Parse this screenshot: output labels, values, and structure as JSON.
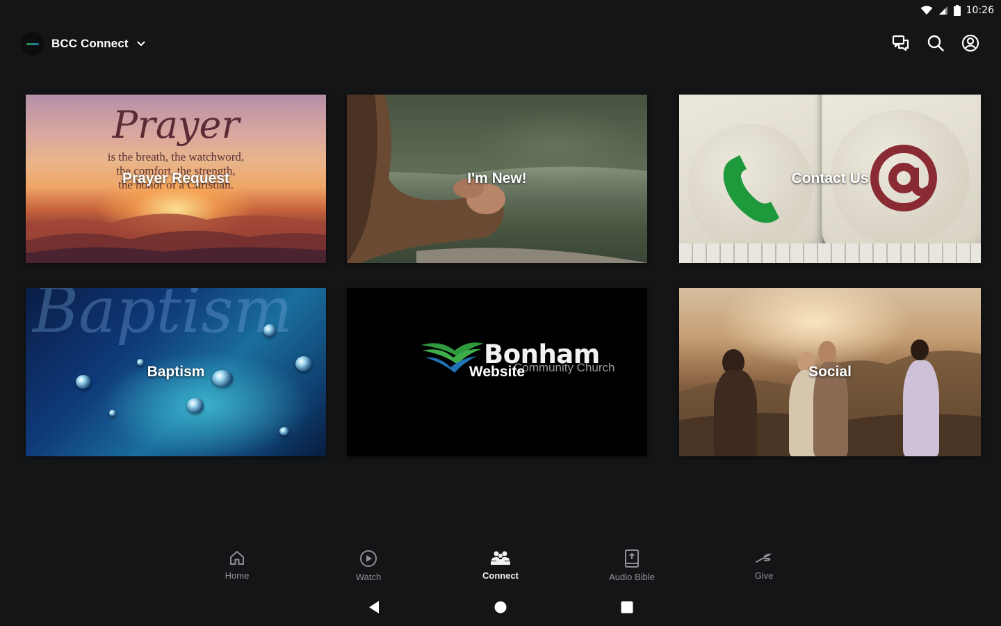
{
  "status_bar": {
    "time": "10:26"
  },
  "app_bar": {
    "title": "BCC Connect",
    "icons": [
      "chat-icon",
      "search-icon",
      "account-icon"
    ]
  },
  "tiles": [
    {
      "label": "Prayer Request",
      "image_text": {
        "title": "Prayer",
        "quote": [
          "is the breath, the watchword,",
          "the comfort, the strength,",
          "the honor of a Christian."
        ]
      }
    },
    {
      "label": "I'm New!"
    },
    {
      "label": "Contact Us"
    },
    {
      "label": "Baptism",
      "image_text": {
        "script": "Baptism"
      }
    },
    {
      "label": "Website",
      "image_text": {
        "brand": "Bonham",
        "sub": "Community Church"
      }
    },
    {
      "label": "Social"
    }
  ],
  "bottom_nav": {
    "active": "Connect",
    "items": [
      {
        "label": "Home",
        "icon": "home-icon"
      },
      {
        "label": "Watch",
        "icon": "play-circle-icon"
      },
      {
        "label": "Connect",
        "icon": "people-icon"
      },
      {
        "label": "Audio Bible",
        "icon": "bible-icon"
      },
      {
        "label": "Give",
        "icon": "give-hand-icon"
      }
    ]
  },
  "system_nav": [
    "back-icon",
    "home-circle-icon",
    "recents-icon"
  ],
  "colors": {
    "background": "#141517",
    "inactive_nav": "#8e9094",
    "active_nav": "#f2f2f2"
  }
}
